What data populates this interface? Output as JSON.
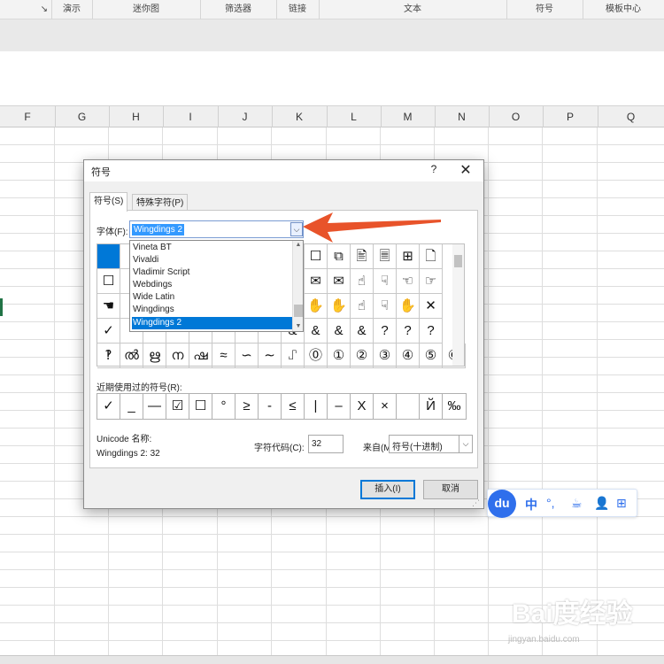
{
  "ribbon": {
    "groups": [
      "演示",
      "迷你图",
      "筛选器",
      "链接",
      "文本",
      "符号",
      "模板中心"
    ],
    "launcher_glyph": "↘"
  },
  "sheet": {
    "columns": [
      "F",
      "G",
      "H",
      "I",
      "J",
      "K",
      "L",
      "M",
      "N",
      "O",
      "P",
      "Q"
    ]
  },
  "dialog": {
    "title": "符号",
    "help": "?",
    "close": "✕",
    "tabs": [
      "符号(S)",
      "特殊字符(P)"
    ],
    "font_label": "字体(F):",
    "font_value": "Wingdings 2",
    "font_list": [
      "Vineta BT",
      "Vivaldi",
      "Vladimir Script",
      "Webdings",
      "Wide Latin",
      "Wingdings",
      "Wingdings 2"
    ],
    "font_list_selected": 6,
    "symbols": [
      [
        "",
        "",
        "",
        "",
        "",
        "",
        "",
        "",
        "🗋",
        "☐",
        "⧉",
        "🖹",
        "🗏",
        "⊞",
        "🗋"
      ],
      [
        "☐",
        "",
        "",
        "",
        "",
        "",
        "",
        "",
        "➿",
        "✉",
        "✉",
        "☝",
        "☟",
        "☜",
        "☞"
      ],
      [
        "☚",
        "",
        "",
        "",
        "",
        "",
        "",
        "",
        "☝",
        "✋",
        "✋",
        "☝",
        "☟",
        "✋",
        "✕"
      ],
      [
        "✓",
        "",
        "",
        "",
        "",
        "",
        "",
        "",
        "&",
        "&",
        "&",
        "&",
        "?",
        "?",
        "?"
      ],
      [
        "‽",
        "ൽ",
        "ഋ",
        "ന",
        "ഷ",
        "≈",
        "∽",
        "∼",
        "⑀",
        "⓪",
        "①",
        "②",
        "③",
        "④",
        "⑤",
        "⑥"
      ]
    ],
    "recent_label": "近期使用过的符号(R):",
    "recent": [
      "✓",
      "_",
      "—",
      "☑",
      "☐",
      "°",
      "≥",
      "-",
      "≤",
      "|",
      "–",
      "Χ",
      "×",
      " ",
      "Й",
      "‰"
    ],
    "unicode_label": "Unicode 名称:",
    "unicode_value": "Wingdings 2: 32",
    "charcode_label": "字符代码(C):",
    "charcode_value": "32",
    "from_label": "来自(M):",
    "from_value": "符号(十进制)",
    "insert": "插入(I)",
    "cancel": "取消"
  },
  "ime": {
    "logo": "du",
    "icons": [
      "中",
      "°,",
      "☕",
      "👤",
      "⊞"
    ]
  },
  "watermark": {
    "text": "Bai度经验",
    "sub": "jingyan.baidu.com"
  },
  "colors": {
    "accent": "#0078d7",
    "arrow": "#e8532a",
    "selection": "#3399ff"
  }
}
